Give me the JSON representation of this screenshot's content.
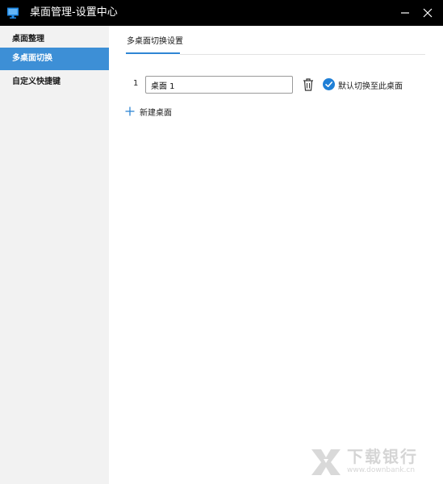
{
  "window": {
    "title": "桌面管理-设置中心",
    "app_icon": "monitor-icon",
    "minimize_icon": "minimize-icon",
    "close_icon": "close-icon"
  },
  "sidebar": {
    "items": [
      {
        "label": "桌面整理",
        "active": false
      },
      {
        "label": "多桌面切换",
        "active": true
      },
      {
        "label": "自定义快捷键",
        "active": false
      }
    ],
    "background": "#f2f2f2",
    "active_color": "#3d8fd6"
  },
  "main": {
    "tab": {
      "label": "多桌面切换设置",
      "underline_color": "#2f86d4"
    },
    "desktops": [
      {
        "index": "1",
        "name": "桌面 1",
        "delete_icon": "trash-icon",
        "default_checked": true,
        "default_label": "默认切换至此桌面",
        "check_color": "#1f7fd6"
      }
    ],
    "new_desktop": {
      "icon": "plus-icon",
      "label": "新建桌面",
      "icon_color": "#2f86d4"
    }
  },
  "watermark": {
    "text": "下载银行",
    "subtext": "www.downbank.cn"
  }
}
